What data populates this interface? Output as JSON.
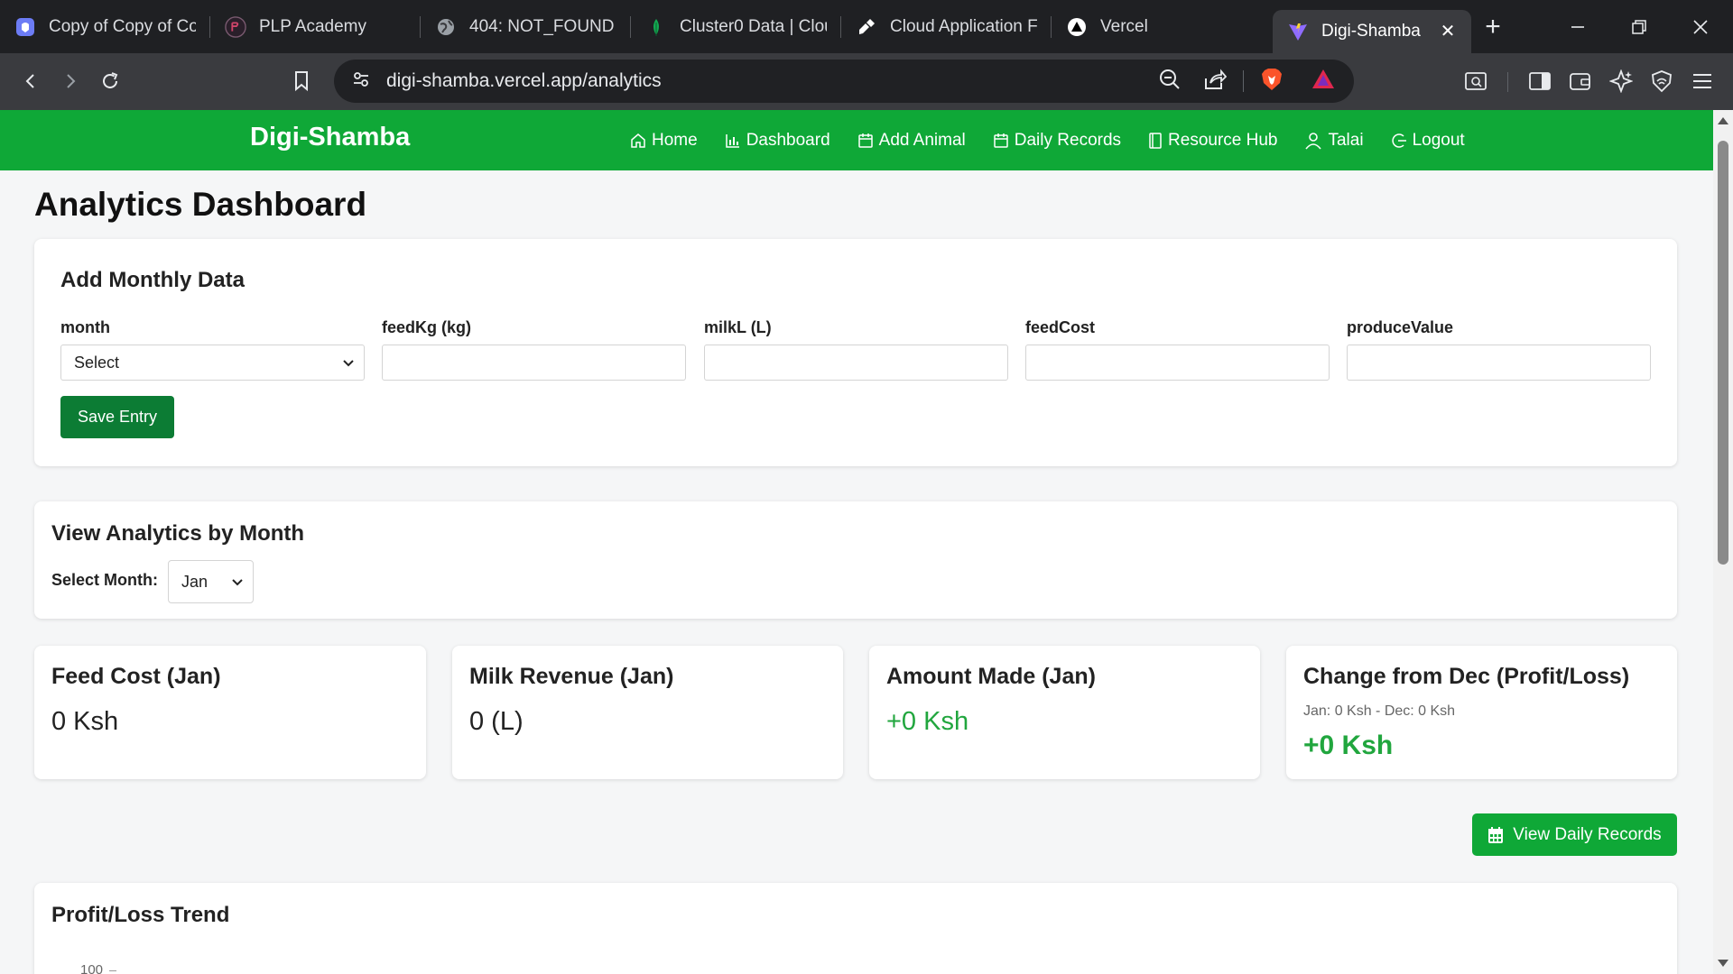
{
  "browser": {
    "tabs": [
      {
        "title": "Copy of Copy of Co",
        "icon": "app-icon"
      },
      {
        "title": "PLP Academy",
        "icon": "plp-icon"
      },
      {
        "title": "404: NOT_FOUND",
        "icon": "globe-icon"
      },
      {
        "title": "Cluster0 Data | Clou",
        "icon": "mongodb-leaf-icon"
      },
      {
        "title": "Cloud Application F",
        "icon": "cloud-app-icon"
      },
      {
        "title": "Vercel",
        "icon": "vercel-triangle-icon"
      },
      {
        "title": "Digi-Shamba",
        "icon": "vite-icon",
        "active": true
      }
    ],
    "url": "digi-shamba.vercel.app/analytics"
  },
  "nav": {
    "brand": "Digi-Shamba",
    "links": [
      {
        "label": "Home",
        "icon": "home-icon"
      },
      {
        "label": "Dashboard",
        "icon": "bar-chart-icon"
      },
      {
        "label": "Add Animal",
        "icon": "calendar-icon"
      },
      {
        "label": "Daily Records",
        "icon": "calendar-icon"
      },
      {
        "label": "Resource Hub",
        "icon": "book-icon"
      },
      {
        "label": "Talai",
        "icon": "user-icon"
      },
      {
        "label": "Logout",
        "icon": "logout-icon"
      }
    ],
    "color": "#0fa837"
  },
  "page": {
    "title": "Analytics Dashboard"
  },
  "monthly_form": {
    "heading": "Add Monthly Data",
    "fields": [
      {
        "label": "month",
        "type": "select",
        "value": "Select"
      },
      {
        "label": "feedKg (kg)",
        "type": "input",
        "value": ""
      },
      {
        "label": "milkL (L)",
        "type": "input",
        "value": ""
      },
      {
        "label": "feedCost",
        "type": "input",
        "value": ""
      },
      {
        "label": "produceValue",
        "type": "input",
        "value": ""
      }
    ],
    "save_label": "Save Entry"
  },
  "view_month": {
    "heading": "View Analytics by Month",
    "select_label": "Select Month:",
    "selected": "Jan"
  },
  "stats": {
    "feed_cost": {
      "title": "Feed Cost (Jan)",
      "value": "0 Ksh"
    },
    "milk_revenue": {
      "title": "Milk Revenue (Jan)",
      "value": "0 (L)"
    },
    "amount_made": {
      "title": "Amount Made (Jan)",
      "value": "+0 Ksh"
    },
    "change": {
      "title": "Change from Dec (Profit/Loss)",
      "detail": "Jan: 0 Ksh - Dec: 0 Ksh",
      "value": "+0 Ksh"
    }
  },
  "actions": {
    "view_daily_label": "View Daily Records"
  },
  "trend": {
    "heading": "Profit/Loss Trend",
    "y_tick_top": "100"
  }
}
